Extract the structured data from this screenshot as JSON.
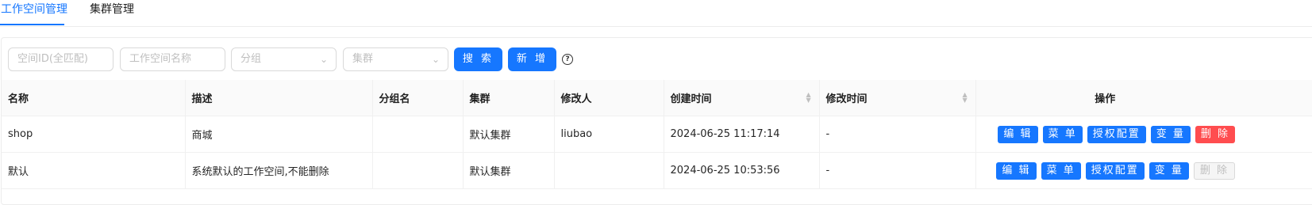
{
  "tabs": [
    {
      "label": "工作空间管理",
      "active": true
    },
    {
      "label": "集群管理",
      "active": false
    }
  ],
  "filters": {
    "space_id_placeholder": "空间ID(全匹配)",
    "space_name_placeholder": "工作空间名称",
    "group_placeholder": "分组",
    "cluster_placeholder": "集群"
  },
  "toolbar": {
    "search_label": "搜 索",
    "add_label": "新 增",
    "help_glyph": "?"
  },
  "table": {
    "columns": [
      "名称",
      "描述",
      "分组名",
      "集群",
      "修改人",
      "创建时间",
      "修改时间",
      "操作"
    ],
    "rows": [
      {
        "name": "shop",
        "description": "商城",
        "group": "",
        "cluster": "默认集群",
        "modifier": "liubao",
        "created": "2024-06-25 11:17:14",
        "modified": "-",
        "delete_enabled": true
      },
      {
        "name": "默认",
        "description": "系统默认的工作空间,不能删除",
        "group": "",
        "cluster": "默认集群",
        "modifier": "",
        "created": "2024-06-25 10:53:56",
        "modified": "-",
        "delete_enabled": false
      }
    ],
    "actions": {
      "edit": "编 辑",
      "menu": "菜 单",
      "auth": "授权配置",
      "variable": "变 量",
      "delete": "删 除"
    }
  },
  "colors": {
    "primary": "#1677ff",
    "danger": "#ff4d4f"
  }
}
